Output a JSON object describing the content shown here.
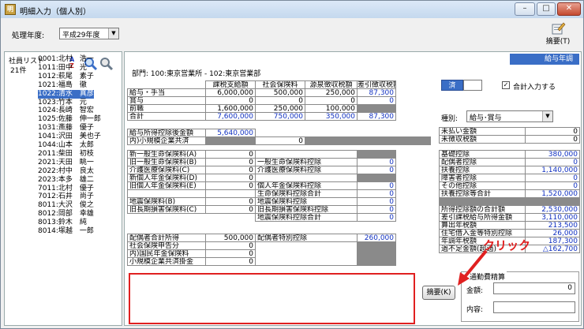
{
  "window": {
    "title": "明細入力（個人別）",
    "app_icon": "明"
  },
  "toolbar": {
    "year_label": "処理年度:",
    "year_value": "平成29年度",
    "summary_label": "摘要(T)"
  },
  "employees": {
    "header": "社員リスト",
    "count": "21件",
    "items": [
      "0001:北村　浩一",
      "1011:田中　光",
      "1012:萩尾　素子",
      "1021:福島　徹",
      "1022:清水　真彦",
      "1023:竹本　元",
      "1024:長崎　智宏",
      "1025:佐藤　伸一郎",
      "1031:斎藤　優子",
      "1041:沢田　美也子",
      "1044:山本　太郎",
      "2011:柴田　初枝",
      "2021:天田　眺一",
      "2022:村中　良太",
      "2023:本多　雄二",
      "7011:北村　優子",
      "7012:石井　尚子",
      "8011:大沢　俊之",
      "8012:岡部　幸雄",
      "8013:鈴木　純",
      "8014:塚越　一郎"
    ],
    "selected_index": 4
  },
  "main": {
    "tab": "給与年調",
    "dept": "部門: 100:東京営業所 - 102:東京営業部",
    "cols": [
      "課税支給額",
      "社会保険料",
      "源泉徴収税額",
      "差引徴収税額"
    ],
    "rows": [
      {
        "label": "給与・手当",
        "v": [
          "6,000,000",
          "500,000",
          "250,000",
          "87,300"
        ]
      },
      {
        "label": "賞与",
        "v": [
          "0",
          "0",
          "0",
          "0"
        ]
      },
      {
        "label": "前職",
        "v": [
          "1,600,000",
          "250,000",
          "100,000",
          ""
        ]
      },
      {
        "label": "合計",
        "v": [
          "7,600,000",
          "750,000",
          "350,000",
          "87,300"
        ]
      }
    ],
    "after_deduction": {
      "label": "給与所得控除後金額",
      "value": "5,640,000"
    },
    "small_biz": {
      "label": "内)小規模企業共済",
      "value": "0"
    },
    "settle_a": "済",
    "settle_b": "",
    "combined_checkbox": "合計入力する",
    "kind_label": "種別:",
    "kind_value": "給与･賞与",
    "unpaid": {
      "label": "未払い金額",
      "value": "0"
    },
    "uncollected": {
      "label": "未徴収税額",
      "value": "0"
    },
    "ins_left": [
      {
        "label": "新一般生命保険料(A)",
        "value": "0"
      },
      {
        "label": "旧一般生命保険料(B)",
        "value": "0"
      },
      {
        "label": "介護医療保険料(C)",
        "value": "0"
      },
      {
        "label": "新個人年金保険料(D)",
        "value": "0"
      },
      {
        "label": "旧個人年金保険料(E)",
        "value": "0"
      },
      {
        "label": "",
        "value": ""
      },
      {
        "label": "地震保険料(B)",
        "value": "0"
      },
      {
        "label": "旧長期損害保険料(C)",
        "value": "0"
      }
    ],
    "ins_mid": [
      {
        "label": "",
        "value": ""
      },
      {
        "label": "一般生命保険料控除",
        "value": "0"
      },
      {
        "label": "介護医療保険料控除",
        "value": "0"
      },
      {
        "label": "",
        "value": ""
      },
      {
        "label": "個人年金保険料控除",
        "value": "0"
      },
      {
        "label": "生命保険料控除合計",
        "value": "0"
      },
      {
        "label": "地震保険料控除",
        "value": "0"
      },
      {
        "label": "旧長期損害保険料控除",
        "value": "0"
      },
      {
        "label": "地震保険料控除合計",
        "value": "0"
      }
    ],
    "ded_right": [
      {
        "label": "基礎控除",
        "value": "380,000"
      },
      {
        "label": "配偶者控除",
        "value": "0"
      },
      {
        "label": "扶養控除",
        "value": "1,140,000"
      },
      {
        "label": "障害者控除",
        "value": "0"
      },
      {
        "label": "その他控除",
        "value": "0"
      },
      {
        "label": "扶養控除等合計",
        "value": "1,520,000"
      },
      {
        "label": "",
        "value": ""
      },
      {
        "label": "所得控除額の合計額",
        "value": "2,530,000"
      },
      {
        "label": "差引課税給与所得金額",
        "value": "3,110,000"
      },
      {
        "label": "算出年税額",
        "value": "213,500"
      },
      {
        "label": "住宅借入金等特別控除",
        "value": "26,000"
      },
      {
        "label": "年調年税額",
        "value": "187,300"
      },
      {
        "label": "過不足金額(超過)",
        "value": "△162,700"
      }
    ],
    "spouse_income": {
      "label": "配偶者合計所得",
      "value": "500,000"
    },
    "spouse_special": {
      "label": "配偶者特別控除",
      "value": "260,000"
    },
    "social_self": {
      "label": "社会保険申告分",
      "value": "0"
    },
    "national_pension": {
      "label": "内)国民年金保険料",
      "value": "0"
    },
    "small_biz_ded": {
      "label": "小規模企業共済掛金",
      "value": "0"
    },
    "summary_btn": "摘要(K)",
    "travel": {
      "header": "通勤費精算",
      "amount_label": "金額:",
      "amount_value": "0",
      "content_label": "内容:"
    },
    "annotation": "クリック"
  },
  "colors": {
    "accent": "#3a6ec6",
    "annotation": "#e02020",
    "value_blue": "#1030c0"
  }
}
